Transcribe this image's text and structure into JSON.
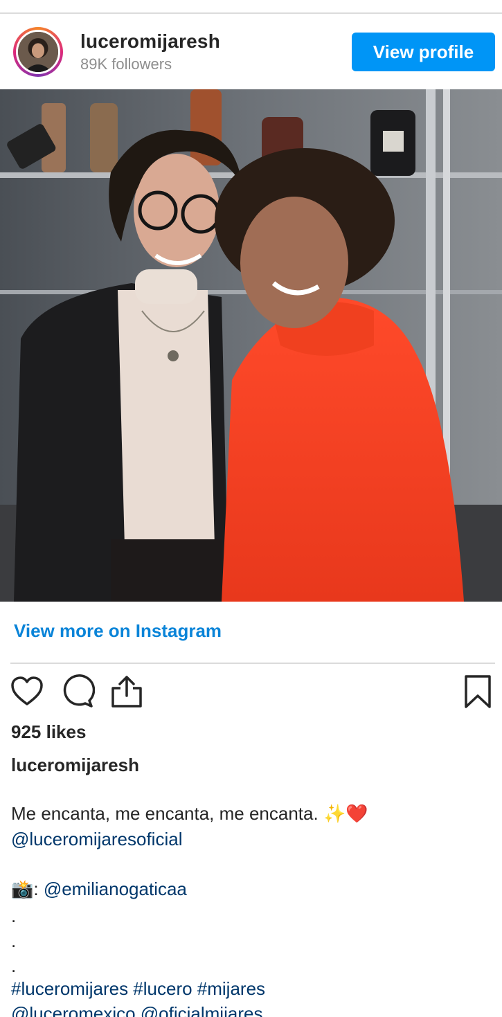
{
  "header": {
    "username": "luceromijaresh",
    "followers": "89K followers",
    "view_profile_label": "View profile"
  },
  "post": {
    "view_more_label": "View more on Instagram",
    "likes": "925 likes",
    "caption_user": "luceromijaresh",
    "caption": {
      "line1_text": "Me encanta, me encanta, me encanta. ",
      "line1_emoji_sparkles": "✨",
      "line1_emoji_heart": "❤️",
      "mention1": "@luceromijaresoficial",
      "camera_emoji": "📸",
      "camera_sep": ": ",
      "mention2": "@emilianogaticaa",
      "dot": ".",
      "hashtags": "#luceromijares #lucero #mijares",
      "mentions_last": "@luceromexico @oficialmijares"
    }
  },
  "icons": {
    "like": "heart-icon",
    "comment": "comment-icon",
    "share": "share-icon",
    "save": "bookmark-icon"
  },
  "colors": {
    "accent": "#0095f6",
    "link": "#00376b",
    "view_more": "#0a84d8",
    "muted": "#8e8e8e",
    "text": "#262626"
  }
}
